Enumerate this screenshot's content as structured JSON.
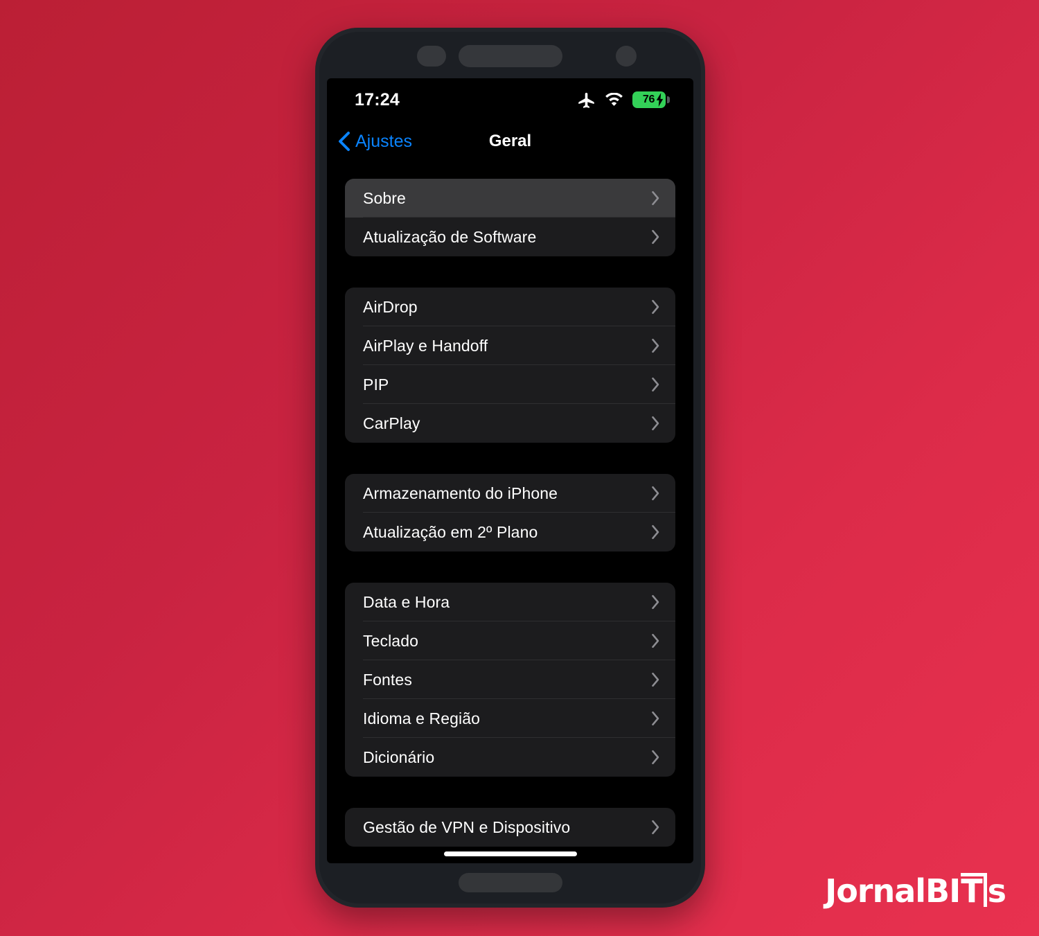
{
  "status_bar": {
    "time": "17:24",
    "icons": [
      "airplane-mode-icon",
      "wifi-icon",
      "battery-charging-icon"
    ],
    "battery_level": "76",
    "battery_charging": true
  },
  "nav_bar": {
    "back_label": "Ajustes",
    "title": "Geral",
    "accent_color": "#0a84ff"
  },
  "groups": [
    {
      "rows": [
        {
          "label": "Sobre",
          "pressed": true
        },
        {
          "label": "Atualização de Software",
          "pressed": false
        }
      ]
    },
    {
      "rows": [
        {
          "label": "AirDrop",
          "pressed": false
        },
        {
          "label": "AirPlay e Handoff",
          "pressed": false
        },
        {
          "label": "PIP",
          "pressed": false
        },
        {
          "label": "CarPlay",
          "pressed": false
        }
      ]
    },
    {
      "rows": [
        {
          "label": "Armazenamento do iPhone",
          "pressed": false
        },
        {
          "label": "Atualização em 2º Plano",
          "pressed": false
        }
      ]
    },
    {
      "rows": [
        {
          "label": "Data e Hora",
          "pressed": false
        },
        {
          "label": "Teclado",
          "pressed": false
        },
        {
          "label": "Fontes",
          "pressed": false
        },
        {
          "label": "Idioma e Região",
          "pressed": false
        },
        {
          "label": "Dicionário",
          "pressed": false
        }
      ]
    },
    {
      "rows": [
        {
          "label": "Gestão de VPN e Dispositivo",
          "pressed": false
        }
      ]
    }
  ],
  "watermark": {
    "part1": "JornalBI",
    "part2": "T",
    "part3": "s"
  },
  "colors": {
    "background_start": "#bb1f35",
    "background_end": "#e8314f",
    "screen": "#000000",
    "group": "#1c1c1e",
    "row_pressed": "#3a3a3c",
    "battery_green": "#33d158",
    "accent_blue": "#0a84ff"
  }
}
